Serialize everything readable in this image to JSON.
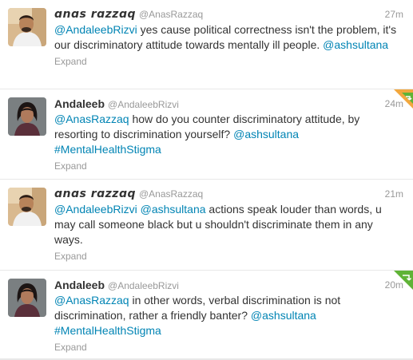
{
  "tweets": [
    {
      "fullname": "ɑnɑs rɑzzɑq",
      "username": "@AnasRazzaq",
      "time": "27m",
      "segments": [
        {
          "text": "@AndaleebRizvi",
          "link": true
        },
        {
          "text": " yes cause political correctness isn't the problem, it's our discriminatory attitude towards mentally ill people. ",
          "link": false
        },
        {
          "text": "@ashsultana",
          "link": true
        }
      ],
      "expand": "Expand",
      "avatar_icon": "man-profile-photo",
      "corner": null
    },
    {
      "fullname": "Andaleeb",
      "username": "@AndaleebRizvi",
      "time": "24m",
      "segments": [
        {
          "text": "@AnasRazzaq",
          "link": true
        },
        {
          "text": " how do you counter discriminatory attitude, by resorting to discrimination yourself? ",
          "link": false
        },
        {
          "text": "@ashsultana",
          "link": true
        },
        {
          "text": " ",
          "link": false
        },
        {
          "text": "#MentalHealthStigma",
          "link": true
        }
      ],
      "expand": "Expand",
      "avatar_icon": "woman-profile-photo",
      "corner": "retweet-favorite-corner-icon",
      "corner_colors": [
        "#f2a73d",
        "#5fb336"
      ]
    },
    {
      "fullname": "ɑnɑs rɑzzɑq",
      "username": "@AnasRazzaq",
      "time": "21m",
      "segments": [
        {
          "text": "@AndaleebRizvi",
          "link": true
        },
        {
          "text": " ",
          "link": false
        },
        {
          "text": "@ashsultana",
          "link": true
        },
        {
          "text": " actions speak louder than words, u may call someone black but u shouldn't discriminate them in any ways.",
          "link": false
        }
      ],
      "expand": "Expand",
      "avatar_icon": "man-profile-photo",
      "corner": null
    },
    {
      "fullname": "Andaleeb",
      "username": "@AndaleebRizvi",
      "time": "20m",
      "segments": [
        {
          "text": "@AnasRazzaq",
          "link": true
        },
        {
          "text": " in other words, verbal discrimination is not discrimination, rather a friendly banter? ",
          "link": false
        },
        {
          "text": "@ashsultana",
          "link": true
        },
        {
          "text": " ",
          "link": false
        },
        {
          "text": "#MentalHealthStigma",
          "link": true
        }
      ],
      "expand": "Expand",
      "avatar_icon": "woman-profile-photo",
      "corner": "retweet-corner-icon",
      "corner_colors": [
        "#5fb336"
      ]
    }
  ],
  "colors": {
    "link": "#0084b4",
    "text": "#333333",
    "muted": "#999999",
    "divider": "#e8e8e8"
  }
}
